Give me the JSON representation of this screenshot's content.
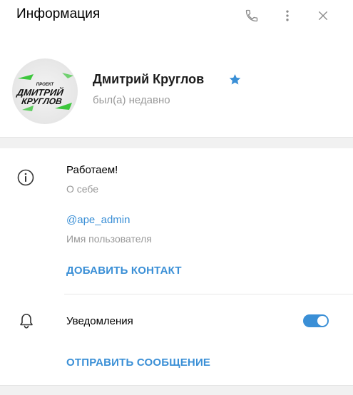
{
  "header": {
    "title": "Информация",
    "icons": [
      "phone-icon",
      "more-vertical-icon",
      "close-icon"
    ]
  },
  "profile": {
    "avatar_text_line1": "ДМИТРИЙ",
    "avatar_text_line2": "КРУГЛОВ",
    "avatar_text_small": "ПРОЕКТ",
    "name": "Дмитрий Круглов",
    "status": "был(а) недавно",
    "badge_icon": "star-icon",
    "badge_color": "#3a8fd6"
  },
  "info": {
    "bio": "Работаем!",
    "bio_label": "О себе",
    "username": "@ape_admin",
    "username_label": "Имя пользователя",
    "add_contact": "ДОБАВИТЬ КОНТАКТ"
  },
  "notifications": {
    "label": "Уведомления",
    "enabled": true,
    "send_message": "ОТПРАВИТЬ СООБЩЕНИЕ"
  },
  "colors": {
    "accent": "#3a8fd6",
    "secondary_text": "#999999",
    "avatar_green": "#3cc63c"
  }
}
